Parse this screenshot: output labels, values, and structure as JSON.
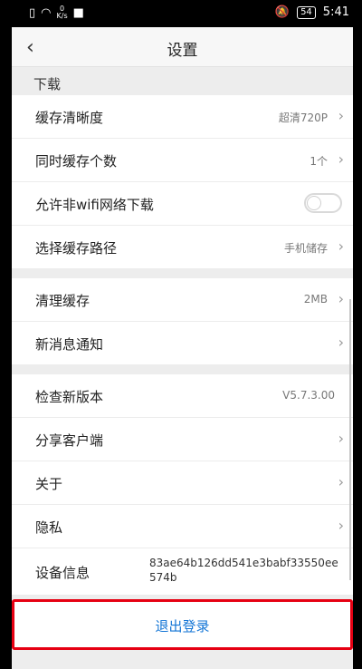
{
  "status": {
    "network_speed_value": "0",
    "network_speed_unit": "K/s",
    "battery": "54",
    "time": "5:41"
  },
  "header": {
    "title": "设置",
    "back_icon": "chevron-left-icon"
  },
  "download": {
    "section_title": "下载",
    "items": [
      {
        "label": "缓存清晰度",
        "value": "超清720P"
      },
      {
        "label": "同时缓存个数",
        "value": "1个"
      },
      {
        "label": "允许非wifi网络下载",
        "toggle": false
      },
      {
        "label": "选择缓存路径",
        "value": "手机储存"
      }
    ]
  },
  "storage": {
    "items": [
      {
        "label": "清理缓存",
        "value": "2MB"
      },
      {
        "label": "新消息通知",
        "value": ""
      }
    ]
  },
  "about": {
    "items": [
      {
        "label": "检查新版本",
        "value": "V5.7.3.00"
      },
      {
        "label": "分享客户端",
        "value": ""
      },
      {
        "label": "关于",
        "value": ""
      },
      {
        "label": "隐私",
        "value": ""
      },
      {
        "label": "设备信息",
        "value": "83ae64b126dd541e3babf33550ee574b"
      }
    ]
  },
  "logout": {
    "label": "退出登录"
  },
  "colors": {
    "accent": "#1476d6",
    "highlight": "#e60012"
  }
}
